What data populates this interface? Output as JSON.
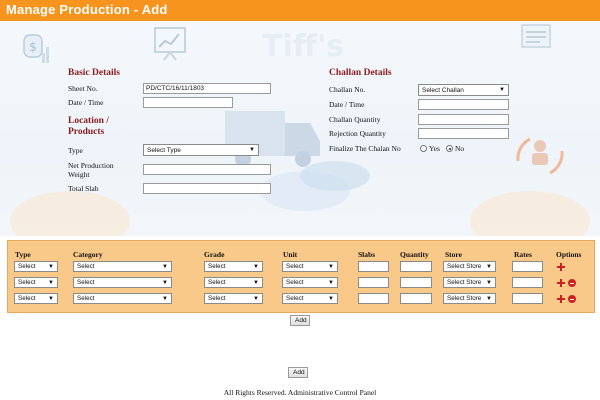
{
  "header": {
    "title": "Manage Production - Add",
    "color": "#f7941d"
  },
  "basic": {
    "heading": "Basic Details",
    "sheet_label": "Sheet No.",
    "sheet_value": "PD/CTC/16/11/1803",
    "date_label": "Date / Time",
    "date_value": ""
  },
  "location": {
    "heading": "Location / Products",
    "type_label": "Type",
    "type_value": "Select Type",
    "netweight_label": "Net Production Weight",
    "netweight_value": "",
    "totalslab_label": "Total Slab",
    "totalslab_value": ""
  },
  "challan": {
    "heading": "Challan Details",
    "no_label": "Challan No.",
    "no_value": "Select Challan",
    "date_label": "Date / Time",
    "qty_label": "Challan Quantity",
    "rej_label": "Rejection Quantity",
    "finalize_label": "Finalize The Chalan No",
    "yes_label": "Yes",
    "no_label_radio": "No",
    "selected": "No"
  },
  "grid": {
    "headers": [
      "Type",
      "Category",
      "Grade",
      "Unit",
      "Slabs",
      "Quantity",
      "Store",
      "Rates",
      "Options"
    ],
    "rows": [
      {
        "type": "Select",
        "category": "Select",
        "grade": "Select",
        "unit": "Select",
        "store": "Select Store"
      },
      {
        "type": "Select",
        "category": "Select",
        "grade": "Select",
        "unit": "Select",
        "store": "Select Store"
      },
      {
        "type": "Select",
        "category": "Select",
        "grade": "Select",
        "unit": "Select",
        "store": "Select Store"
      }
    ],
    "add_label": "Add"
  },
  "submit_label": "Add",
  "footer": "All Rights Reserved. Administrative Control Panel"
}
